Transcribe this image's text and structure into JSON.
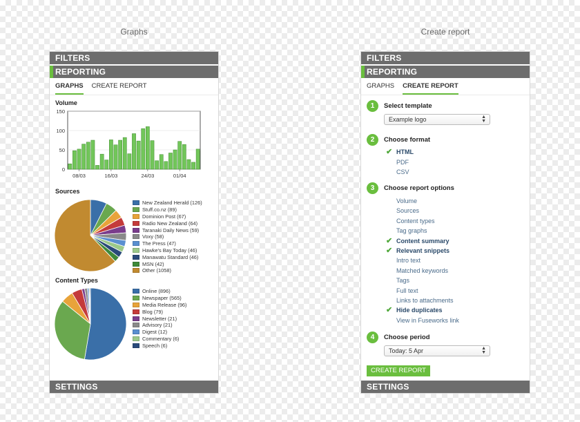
{
  "captions": {
    "left": "Graphs",
    "right": "Create report"
  },
  "panel": {
    "filters": "FILTERS",
    "reporting": "REPORTING",
    "settings": "SETTINGS"
  },
  "tabs": {
    "graphs": "GRAPHS",
    "create": "CREATE REPORT"
  },
  "accent": "#6abe3e",
  "volume": {
    "title": "Volume",
    "chart_data": {
      "type": "bar",
      "title": "Volume",
      "ylim": [
        0,
        150
      ],
      "yticks": [
        "0",
        "50",
        "100",
        "150"
      ],
      "xticks": [
        "08/03",
        "16/03",
        "24/03",
        "01/04"
      ],
      "values": [
        14,
        48,
        52,
        65,
        70,
        75,
        10,
        39,
        24,
        76,
        63,
        75,
        82,
        40,
        92,
        73,
        105,
        110,
        74,
        22,
        38,
        20,
        42,
        50,
        72,
        64,
        25,
        18,
        52
      ],
      "color": "#72c65a"
    }
  },
  "sources": {
    "title": "Sources",
    "chart_data": {
      "type": "pie",
      "slices": [
        {
          "label": "New Zealand Herald (126)",
          "value": 126,
          "color": "#3a6fa8"
        },
        {
          "label": "Stuff.co.nz (89)",
          "value": 89,
          "color": "#6aa84f"
        },
        {
          "label": "Dominion Post (67)",
          "value": 67,
          "color": "#e8a33a"
        },
        {
          "label": "Radio New Zealand (64)",
          "value": 64,
          "color": "#c43b3b"
        },
        {
          "label": "Taranaki Daily News (59)",
          "value": 59,
          "color": "#7a3d8c"
        },
        {
          "label": "Voxy (58)",
          "value": 58,
          "color": "#8a8a8a"
        },
        {
          "label": "The Press (47)",
          "value": 47,
          "color": "#5a8fd0"
        },
        {
          "label": "Hawke's Bay Today (46)",
          "value": 46,
          "color": "#9cc98a"
        },
        {
          "label": "Manawatu Standard (46)",
          "value": 46,
          "color": "#2a4a7a"
        },
        {
          "label": "MSN (42)",
          "value": 42,
          "color": "#3f8a3a"
        },
        {
          "label": "Other (1058)",
          "value": 1058,
          "color": "#c18a30"
        }
      ]
    }
  },
  "content_types": {
    "title": "Content Types",
    "chart_data": {
      "type": "pie",
      "slices": [
        {
          "label": "Online (896)",
          "value": 896,
          "color": "#3a6fa8"
        },
        {
          "label": "Newspaper (565)",
          "value": 565,
          "color": "#6aa84f"
        },
        {
          "label": "Media Release (96)",
          "value": 96,
          "color": "#e8a33a"
        },
        {
          "label": "Blog (79)",
          "value": 79,
          "color": "#c43b3b"
        },
        {
          "label": "Newsletter (21)",
          "value": 21,
          "color": "#7a3d8c"
        },
        {
          "label": "Advisory (21)",
          "value": 21,
          "color": "#8a8a8a"
        },
        {
          "label": "Digest (12)",
          "value": 12,
          "color": "#5a8fd0"
        },
        {
          "label": "Commentary (6)",
          "value": 6,
          "color": "#9cc98a"
        },
        {
          "label": "Speech (6)",
          "value": 6,
          "color": "#2a4a7a"
        }
      ]
    }
  },
  "report": {
    "step1": {
      "num": "1",
      "title": "Select template",
      "value": "Example logo"
    },
    "step2": {
      "num": "2",
      "title": "Choose format",
      "options": [
        {
          "label": "HTML",
          "checked": true
        },
        {
          "label": "PDF",
          "checked": false
        },
        {
          "label": "CSV",
          "checked": false
        }
      ]
    },
    "step3": {
      "num": "3",
      "title": "Choose report options",
      "options": [
        {
          "label": "Volume",
          "checked": false
        },
        {
          "label": "Sources",
          "checked": false
        },
        {
          "label": "Content types",
          "checked": false
        },
        {
          "label": "Tag graphs",
          "checked": false
        },
        {
          "label": "Content summary",
          "checked": true
        },
        {
          "label": "Relevant snippets",
          "checked": true
        },
        {
          "label": "Intro text",
          "checked": false
        },
        {
          "label": "Matched keywords",
          "checked": false
        },
        {
          "label": "Tags",
          "checked": false
        },
        {
          "label": "Full text",
          "checked": false
        },
        {
          "label": "Links to attachments",
          "checked": false
        },
        {
          "label": "Hide duplicates",
          "checked": true
        },
        {
          "label": "View in Fuseworks link",
          "checked": false
        }
      ]
    },
    "step4": {
      "num": "4",
      "title": "Choose period",
      "value": "Today: 5 Apr"
    },
    "button": "CREATE REPORT"
  }
}
